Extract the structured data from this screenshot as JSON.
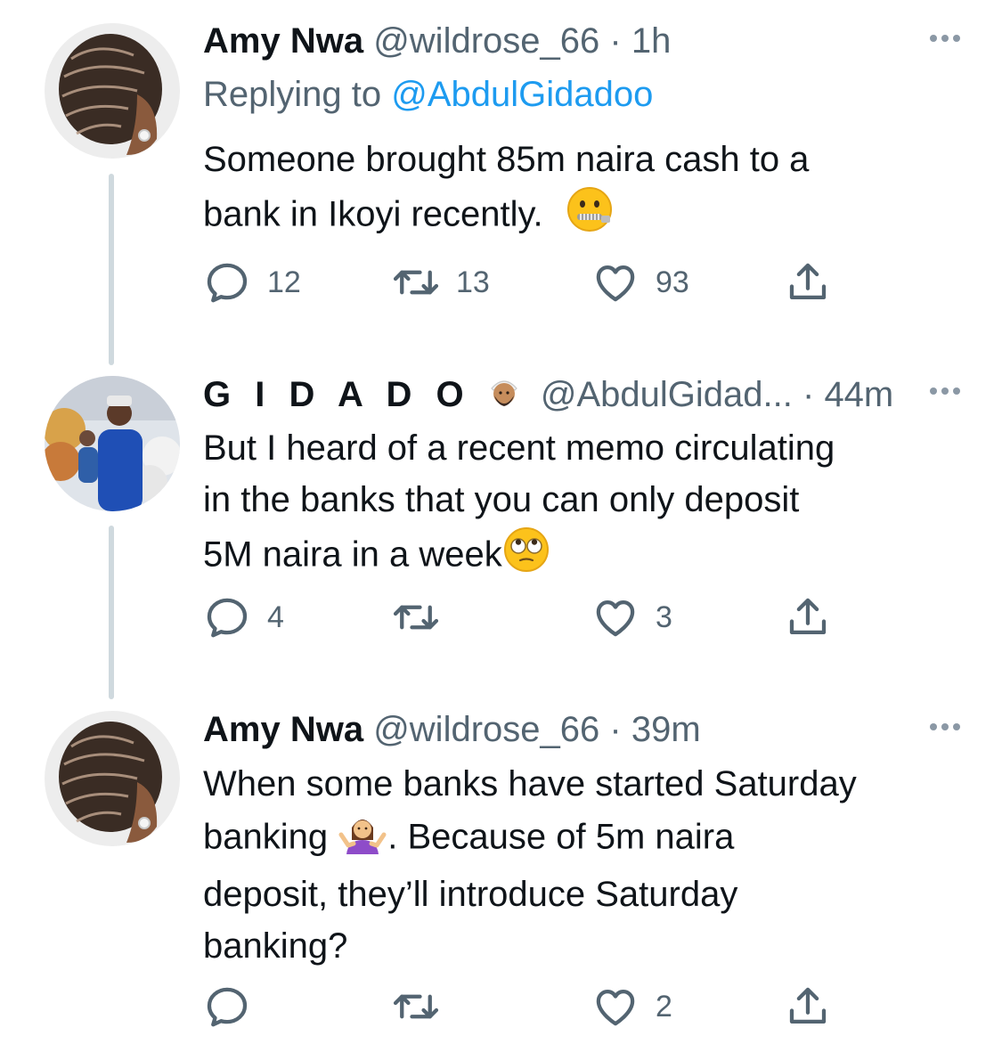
{
  "tweets": [
    {
      "name": "Amy Nwa",
      "handle": "@wildrose_66",
      "dot": "·",
      "time": "1h",
      "replying_prefix": "Replying to ",
      "replying_handle": "@AbdulGidadoo",
      "text_line1": "Someone brought 85m naira cash to a",
      "text_line2": "bank in Ikoyi recently. ",
      "emoji": "zipper-mouth-face",
      "replies": "12",
      "retweets": "13",
      "likes": "93"
    },
    {
      "name": "G I D A D O",
      "name_emoji": "man-with-turban",
      "handle": "@AbdulGidad...",
      "dot": "·",
      "time": "44m",
      "text_line1": "But I heard of a recent memo circulating",
      "text_line2": "in the banks that you can only deposit",
      "text_line3": "5M naira in a week",
      "emoji": "face-with-rolling-eyes",
      "replies": "4",
      "retweets": "",
      "likes": "3"
    },
    {
      "name": "Amy Nwa",
      "handle": "@wildrose_66",
      "dot": "·",
      "time": "39m",
      "text_line1": "When some banks have started Saturday",
      "text_line2a": "banking ",
      "text_line2b": ". Because of 5m naira",
      "text_line3": "deposit, they’ll introduce Saturday",
      "text_line4": "banking?",
      "emoji": "person-shrugging",
      "replies": "",
      "retweets": "",
      "likes": "2"
    }
  ],
  "colors": {
    "text": "#0f1419",
    "secondary": "#536471",
    "link": "#1d9bf0",
    "thread_line": "#cfd9de"
  }
}
